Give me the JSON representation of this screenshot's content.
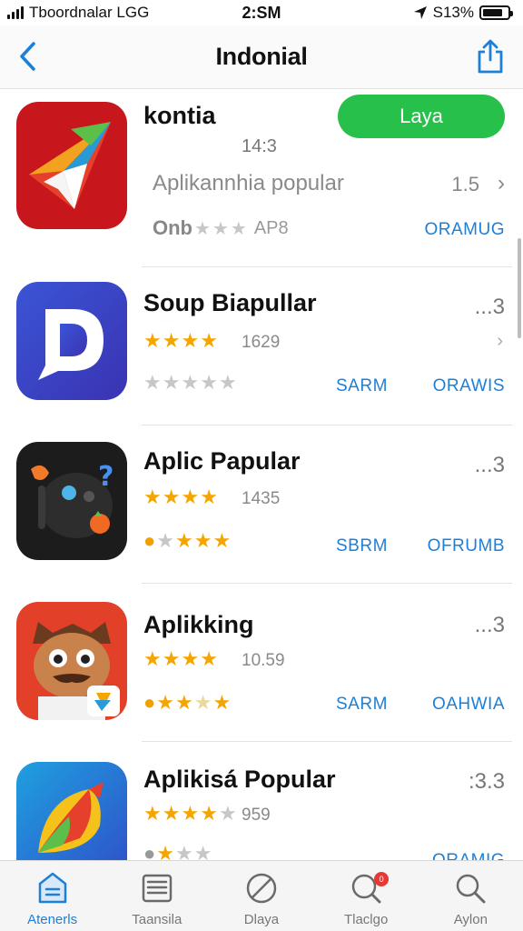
{
  "status_bar": {
    "carrier": "Tboordnalar LGG",
    "time": "2:SM",
    "battery": "S13%",
    "battery_level": 0.8
  },
  "nav": {
    "title": "Indonial",
    "back_icon": "chevron-left-icon",
    "share_icon": "share-icon"
  },
  "apps": [
    {
      "name": "kontia",
      "button_label": "Laya",
      "meta": "14:3",
      "subtitle": "Aplikannhia popular",
      "size": "1.5",
      "rating_text": "Onb",
      "rating_code": "AP8",
      "get_label": "ORAMUG",
      "stars_full": 2,
      "accent": "#c8161d"
    },
    {
      "name": "Soup Biapullar",
      "rank": "...3",
      "rating_count": "1629",
      "price_label": "SARM",
      "get_label": "ORAWIS",
      "stars_full": 4,
      "accent": "#3b49c8"
    },
    {
      "name": "Aplic Papular",
      "rank": "...3",
      "rating_count": "1435",
      "price_label": "SBRM",
      "get_label": "OFRUMB",
      "stars_full": 4,
      "accent": "#1a1a1a"
    },
    {
      "name": "Aplikking",
      "rank": "...3",
      "rating_count": "10.59",
      "price_label": "SARM",
      "get_label": "OAHWIA",
      "stars_full": 4,
      "accent": "#e3402a"
    },
    {
      "name": "Aplikisá Popular",
      "rank": ":3.3",
      "rating_count": "959",
      "get_label": "ORAMIG",
      "stars_full": 4,
      "accent": "#2f8ed8"
    }
  ],
  "tabs": [
    {
      "label": "Atenerls",
      "icon": "today-icon"
    },
    {
      "label": "Taansila",
      "icon": "games-icon"
    },
    {
      "label": "Dlaya",
      "icon": "apps-icon"
    },
    {
      "label": "Tlaclgo",
      "icon": "updates-icon",
      "badge": "0"
    },
    {
      "label": "Aylon",
      "icon": "search-icon"
    }
  ],
  "colors": {
    "accent": "#1c7fd8",
    "install_button": "#26c04b",
    "star": "#f5a500"
  }
}
